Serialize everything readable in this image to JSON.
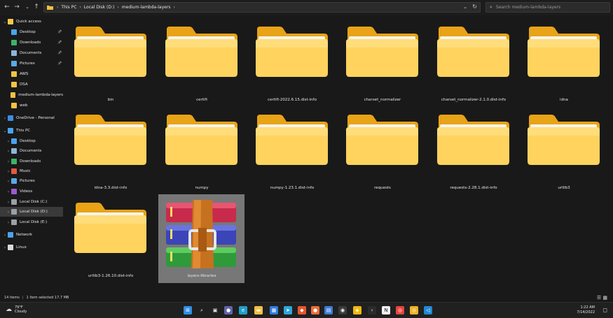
{
  "address": {
    "crumbs": [
      "This PC",
      "Local Disk (D:)",
      "medium-lambda-layers"
    ]
  },
  "search": {
    "placeholder": "Search medium-lambda-layers"
  },
  "sidebar": {
    "items": [
      {
        "label": "Quick access",
        "indent": 0,
        "expand": "open",
        "icon": "star-icon",
        "color": "#f2c94c",
        "pinned": false
      },
      {
        "label": "Desktop",
        "indent": 1,
        "expand": "",
        "icon": "desktop-icon",
        "color": "#4aa3f0",
        "pinned": true
      },
      {
        "label": "Downloads",
        "indent": 1,
        "expand": "",
        "icon": "download-icon",
        "color": "#3bb36a",
        "pinned": true
      },
      {
        "label": "Documents",
        "indent": 1,
        "expand": "",
        "icon": "documents-icon",
        "color": "#8fb4d9",
        "pinned": true
      },
      {
        "label": "Pictures",
        "indent": 1,
        "expand": "",
        "icon": "pictures-icon",
        "color": "#5aa9e6",
        "pinned": true
      },
      {
        "label": "AWS",
        "indent": 1,
        "expand": "",
        "icon": "folder-icon",
        "color": "#f5c244",
        "pinned": false
      },
      {
        "label": "DSA",
        "indent": 1,
        "expand": "",
        "icon": "folder-icon",
        "color": "#f5c244",
        "pinned": false
      },
      {
        "label": "medium-lambda-layers",
        "indent": 1,
        "expand": "",
        "icon": "folder-icon",
        "color": "#f5c244",
        "pinned": false
      },
      {
        "label": "web",
        "indent": 1,
        "expand": "",
        "icon": "folder-icon",
        "color": "#f5c244",
        "pinned": false
      },
      {
        "label": "OneDrive - Personal",
        "indent": 0,
        "expand": "closed",
        "icon": "cloud-icon",
        "color": "#3a8ee6",
        "pinned": false
      },
      {
        "label": "This PC",
        "indent": 0,
        "expand": "open",
        "icon": "computer-icon",
        "color": "#4aa3f0",
        "pinned": false
      },
      {
        "label": "Desktop",
        "indent": 1,
        "expand": "closed",
        "icon": "desktop-icon",
        "color": "#4aa3f0",
        "pinned": false
      },
      {
        "label": "Documents",
        "indent": 1,
        "expand": "closed",
        "icon": "documents-icon",
        "color": "#8fb4d9",
        "pinned": false
      },
      {
        "label": "Downloads",
        "indent": 1,
        "expand": "closed",
        "icon": "download-icon",
        "color": "#3bb36a",
        "pinned": false
      },
      {
        "label": "Music",
        "indent": 1,
        "expand": "closed",
        "icon": "music-icon",
        "color": "#e25a3c",
        "pinned": false
      },
      {
        "label": "Pictures",
        "indent": 1,
        "expand": "closed",
        "icon": "pictures-icon",
        "color": "#5aa9e6",
        "pinned": false
      },
      {
        "label": "Videos",
        "indent": 1,
        "expand": "closed",
        "icon": "videos-icon",
        "color": "#9b59d0",
        "pinned": false
      },
      {
        "label": "Local Disk (C:)",
        "indent": 1,
        "expand": "closed",
        "icon": "drive-icon",
        "color": "#9aa0a6",
        "pinned": false
      },
      {
        "label": "Local Disk (D:)",
        "indent": 1,
        "expand": "closed",
        "icon": "drive-icon",
        "color": "#9aa0a6",
        "pinned": false,
        "selected": true
      },
      {
        "label": "Local Disk (E:)",
        "indent": 1,
        "expand": "closed",
        "icon": "drive-icon",
        "color": "#9aa0a6",
        "pinned": false
      },
      {
        "label": "Network",
        "indent": 0,
        "expand": "closed",
        "icon": "network-icon",
        "color": "#4aa3f0",
        "pinned": false
      },
      {
        "label": "Linux",
        "indent": 0,
        "expand": "closed",
        "icon": "linux-icon",
        "color": "#d9d9d9",
        "pinned": false
      }
    ]
  },
  "files": [
    {
      "name": "bin",
      "type": "folder"
    },
    {
      "name": "certifi",
      "type": "folder"
    },
    {
      "name": "certifi-2022.6.15.dist-info",
      "type": "folder"
    },
    {
      "name": "charset_normalizer",
      "type": "folder"
    },
    {
      "name": "charset_normalizer-2.1.0.dist-info",
      "type": "folder"
    },
    {
      "name": "idna",
      "type": "folder"
    },
    {
      "name": "idna-3.3.dist-info",
      "type": "folder"
    },
    {
      "name": "numpy",
      "type": "folder"
    },
    {
      "name": "numpy-1.23.1.dist-info",
      "type": "folder"
    },
    {
      "name": "requests",
      "type": "folder"
    },
    {
      "name": "requests-2.28.1.dist-info",
      "type": "folder"
    },
    {
      "name": "urllib3",
      "type": "folder"
    },
    {
      "name": "urllib3-1.26.10.dist-info",
      "type": "folder"
    },
    {
      "name": "layers-libraries",
      "type": "archive",
      "selected": true
    }
  ],
  "status": {
    "count": "14 items",
    "selected": "1 item selected  17.7 MB"
  },
  "taskbar": {
    "temp": "79°F",
    "weather": "Cloudy",
    "time": "1:22 AM",
    "date": "7/14/2022",
    "apps": [
      {
        "icon": "windows-start-icon",
        "color": "#2f8fe8",
        "glyph": "⊞",
        "badge": ""
      },
      {
        "icon": "search-icon",
        "color": "",
        "glyph": "⌕",
        "badge": ""
      },
      {
        "icon": "task-view-icon",
        "color": "",
        "glyph": "▣",
        "badge": ""
      },
      {
        "icon": "teams-chat-icon",
        "color": "#6264a7",
        "glyph": "●",
        "badge": ""
      },
      {
        "icon": "edge-icon",
        "color": "#1fa0c8",
        "glyph": "e",
        "badge": ""
      },
      {
        "icon": "file-explorer-icon",
        "color": "#f3c040",
        "glyph": "▬",
        "badge": ""
      },
      {
        "icon": "store-icon",
        "color": "#2f7de1",
        "glyph": "▦",
        "badge": ""
      },
      {
        "icon": "telegram-icon",
        "color": "#2ea6da",
        "glyph": "➤",
        "badge": ""
      },
      {
        "icon": "git-icon",
        "color": "#e7552c",
        "glyph": "◆",
        "badge": ""
      },
      {
        "icon": "postman-icon",
        "color": "#ef6c35",
        "glyph": "●",
        "badge": ""
      },
      {
        "icon": "app-icon",
        "color": "#3d7bd6",
        "glyph": "▤",
        "badge": ""
      },
      {
        "icon": "camera-icon",
        "color": "#3a3a3a",
        "glyph": "◉",
        "badge": ""
      },
      {
        "icon": "binance-icon",
        "color": "#f0b90b",
        "glyph": "◈",
        "badge": ""
      },
      {
        "icon": "terminal-icon",
        "color": "#2b2b2b",
        "glyph": "›",
        "badge": ""
      },
      {
        "icon": "notion-icon",
        "color": "#f0f0f0",
        "glyph": "N",
        "badge": ""
      },
      {
        "icon": "chrome-icon",
        "color": "#e7453b",
        "glyph": "◎",
        "badge": ""
      },
      {
        "icon": "chrome-dev-icon",
        "color": "#f0b323",
        "glyph": "◎",
        "badge": ""
      },
      {
        "icon": "vscode-icon",
        "color": "#1f8ad2",
        "glyph": "◁",
        "badge": ""
      }
    ]
  }
}
